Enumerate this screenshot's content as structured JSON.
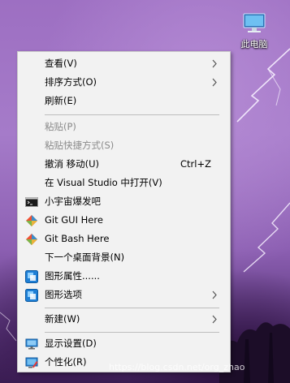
{
  "desktop": {
    "icon_label": "此电脑",
    "watermark": "https://blog.csdn.net/org_zhao"
  },
  "menu": {
    "items": [
      {
        "label": "查看(V)",
        "submenu": true
      },
      {
        "label": "排序方式(O)",
        "submenu": true
      },
      {
        "label": "刷新(E)"
      },
      {
        "label": "粘贴(P)",
        "disabled": true
      },
      {
        "label": "粘贴快捷方式(S)",
        "disabled": true
      },
      {
        "label": "撤消 移动(U)",
        "shortcut": "Ctrl+Z"
      },
      {
        "label": "在 Visual Studio 中打开(V)"
      },
      {
        "label": "小宇宙爆发吧",
        "icon": "terminal-icon"
      },
      {
        "label": "Git GUI Here",
        "icon": "git-icon"
      },
      {
        "label": "Git Bash Here",
        "icon": "git-icon"
      },
      {
        "label": "下一个桌面背景(N)"
      },
      {
        "label": "图形属性......",
        "icon": "intel-graphics-icon"
      },
      {
        "label": "图形选项",
        "icon": "intel-graphics-icon",
        "submenu": true
      },
      {
        "label": "新建(W)",
        "submenu": true
      },
      {
        "label": "显示设置(D)",
        "icon": "display-icon"
      },
      {
        "label": "个性化(R)",
        "icon": "personalize-icon"
      }
    ]
  },
  "colors": {
    "menu_bg": "#f2f2f2",
    "disabled_text": "#8a8a8a",
    "separator": "#bdbdbd"
  }
}
